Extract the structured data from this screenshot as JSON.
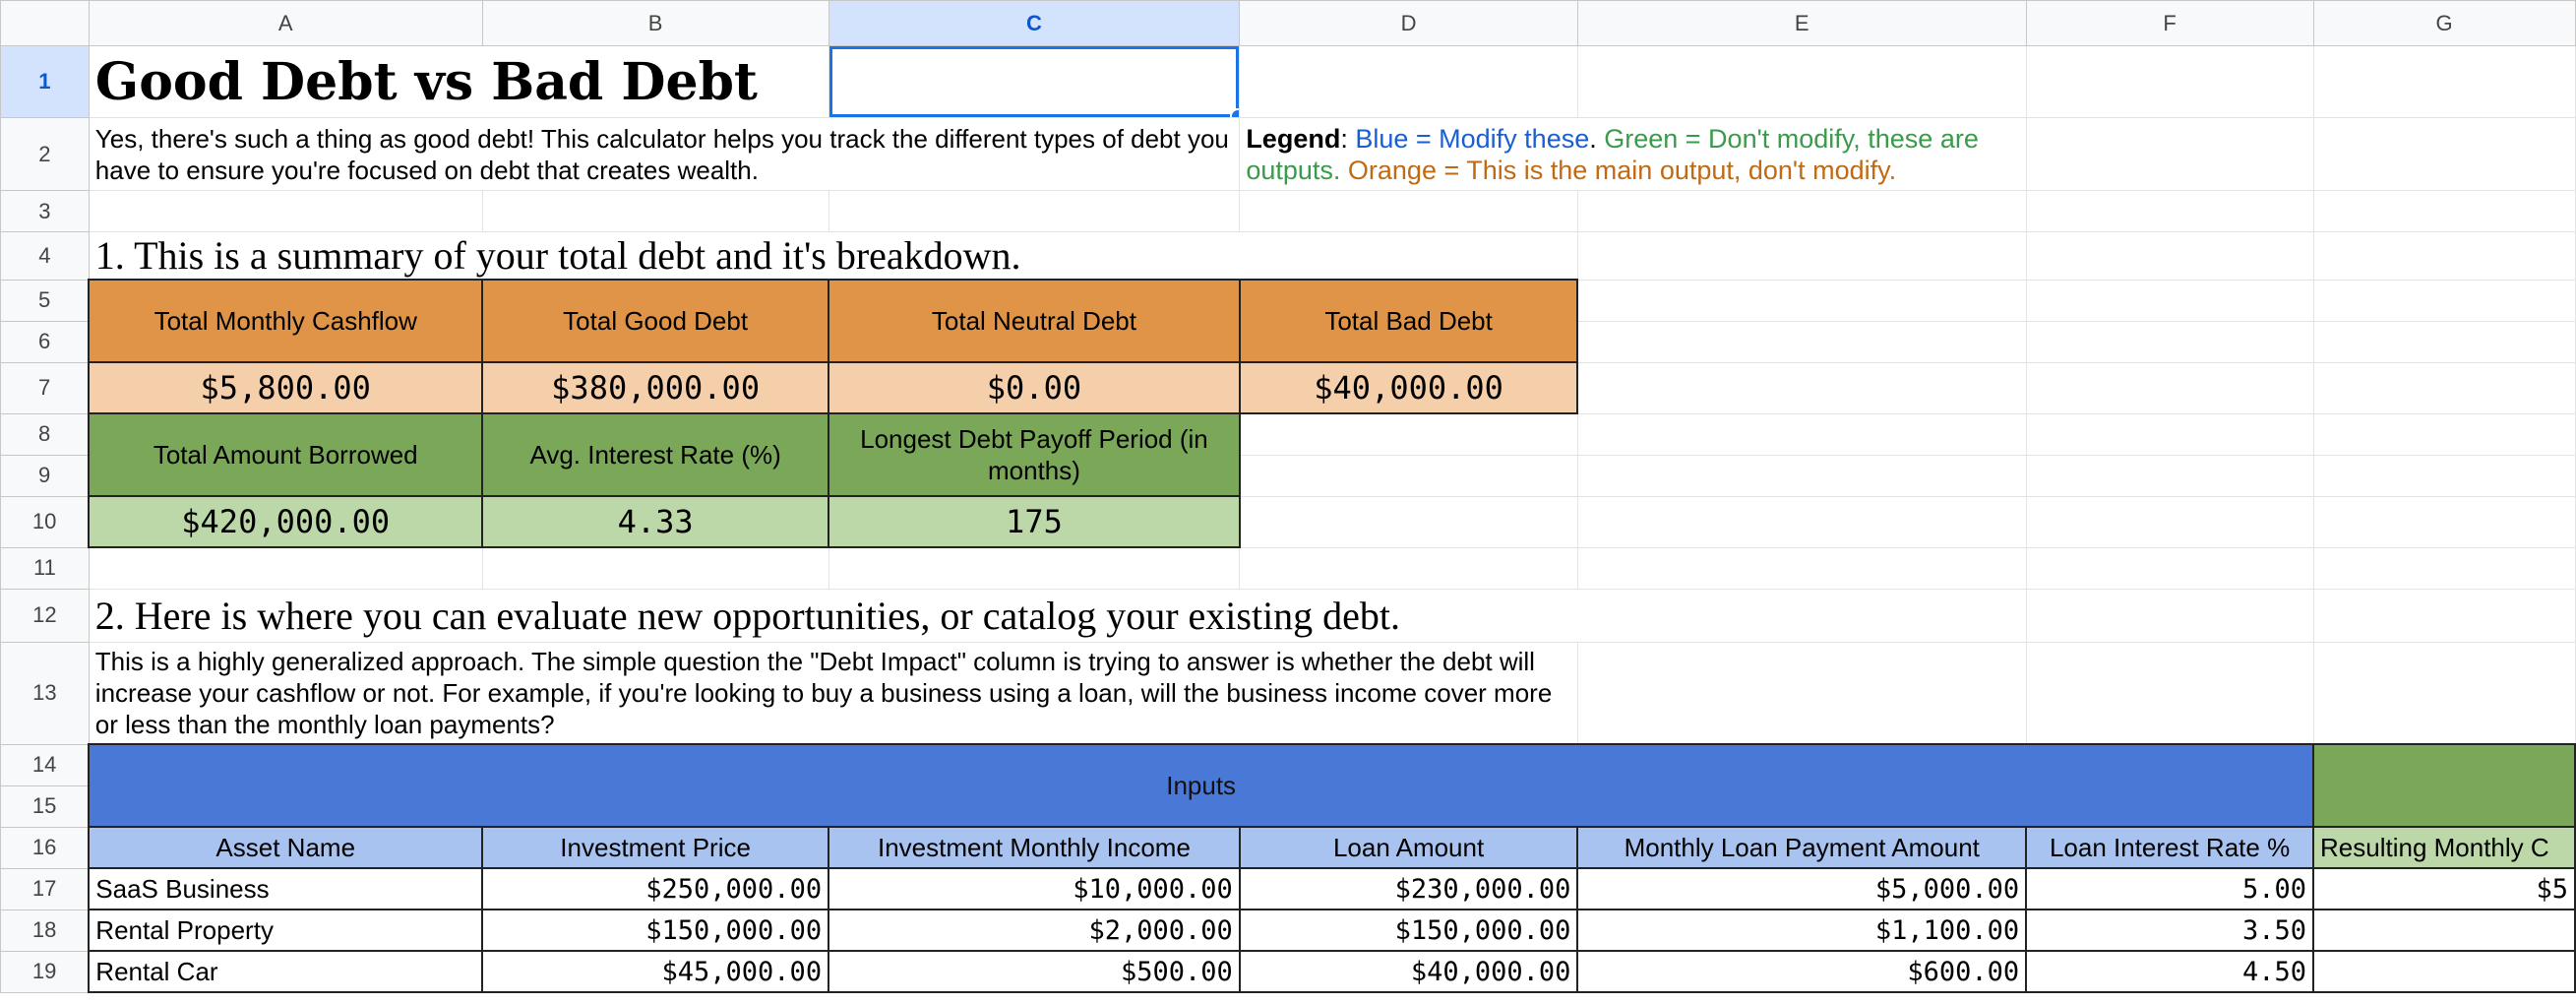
{
  "columns": [
    "A",
    "B",
    "C",
    "D",
    "E",
    "F",
    "G"
  ],
  "rows": [
    "1",
    "2",
    "3",
    "4",
    "5",
    "6",
    "7",
    "8",
    "9",
    "10",
    "11",
    "12",
    "13",
    "14",
    "15",
    "16",
    "17",
    "18",
    "19"
  ],
  "title": "Good Debt vs Bad Debt",
  "intro": "Yes, there's such a thing as good debt! This calculator helps you track the different types of debt you have to ensure you're focused on debt that creates wealth.",
  "legend": {
    "label": "Legend",
    "blue": "Blue = Modify these",
    "green": "Green = Don't modify, these are outputs.",
    "orange": "Orange = This is the main output, don't modify."
  },
  "section1": "1. This is a summary of your total debt and it's breakdown.",
  "summary": {
    "monthly_cashflow_label": "Total Monthly Cashflow",
    "good_debt_label": "Total Good Debt",
    "neutral_debt_label": "Total Neutral Debt",
    "bad_debt_label": "Total Bad Debt",
    "monthly_cashflow": "$5,800.00",
    "good_debt": "$380,000.00",
    "neutral_debt": "$0.00",
    "bad_debt": "$40,000.00",
    "borrowed_label": "Total Amount Borrowed",
    "avg_rate_label": "Avg. Interest Rate (%)",
    "payoff_label": "Longest Debt Payoff Period (in months)",
    "borrowed": "$420,000.00",
    "avg_rate": "4.33",
    "payoff": "175"
  },
  "section2": "2. Here is where you can evaluate new opportunities, or catalog your existing debt.",
  "section2_desc": "This is a highly generalized approach. The simple question the \"Debt Impact\" column is trying to answer is whether the debt will increase your cashflow or not. For example, if you're looking to buy a business using a loan, will the business income cover more or less than the monthly loan payments?",
  "inputs_label": "Inputs",
  "table_headers": [
    "Asset Name",
    "Investment Price",
    "Investment Monthly Income",
    "Loan Amount",
    "Monthly Loan Payment Amount",
    "Loan Interest Rate %",
    "Resulting Monthly C"
  ],
  "table_rows": [
    {
      "asset": "SaaS Business",
      "price": "$250,000.00",
      "income": "$10,000.00",
      "loan": "$230,000.00",
      "payment": "$5,000.00",
      "rate": "5.00",
      "result": "$5"
    },
    {
      "asset": "Rental Property",
      "price": "$150,000.00",
      "income": "$2,000.00",
      "loan": "$150,000.00",
      "payment": "$1,100.00",
      "rate": "3.50",
      "result": ""
    },
    {
      "asset": "Rental Car",
      "price": "$45,000.00",
      "income": "$500.00",
      "loan": "$40,000.00",
      "payment": "$600.00",
      "rate": "4.50",
      "result": ""
    }
  ]
}
